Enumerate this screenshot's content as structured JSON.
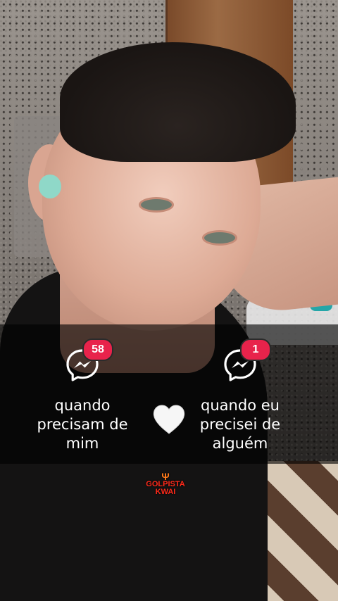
{
  "background": {
    "description_icon": "portrait-photo"
  },
  "left": {
    "icon": "messenger-icon",
    "badge": "58",
    "caption_lines": [
      "quando",
      "precisam de",
      "mim"
    ]
  },
  "center": {
    "icon": "white-heart-icon"
  },
  "right": {
    "icon": "messenger-icon",
    "badge": "1",
    "caption_lines": [
      "quando eu",
      "precisei de",
      "alguém"
    ]
  },
  "watermark": {
    "line1": "GOLPISTA",
    "line2": "KWAI"
  },
  "colors": {
    "badge": "#e8234b",
    "overlay": "rgba(0,0,0,0.62)",
    "watermark": "#ff2a1a"
  }
}
